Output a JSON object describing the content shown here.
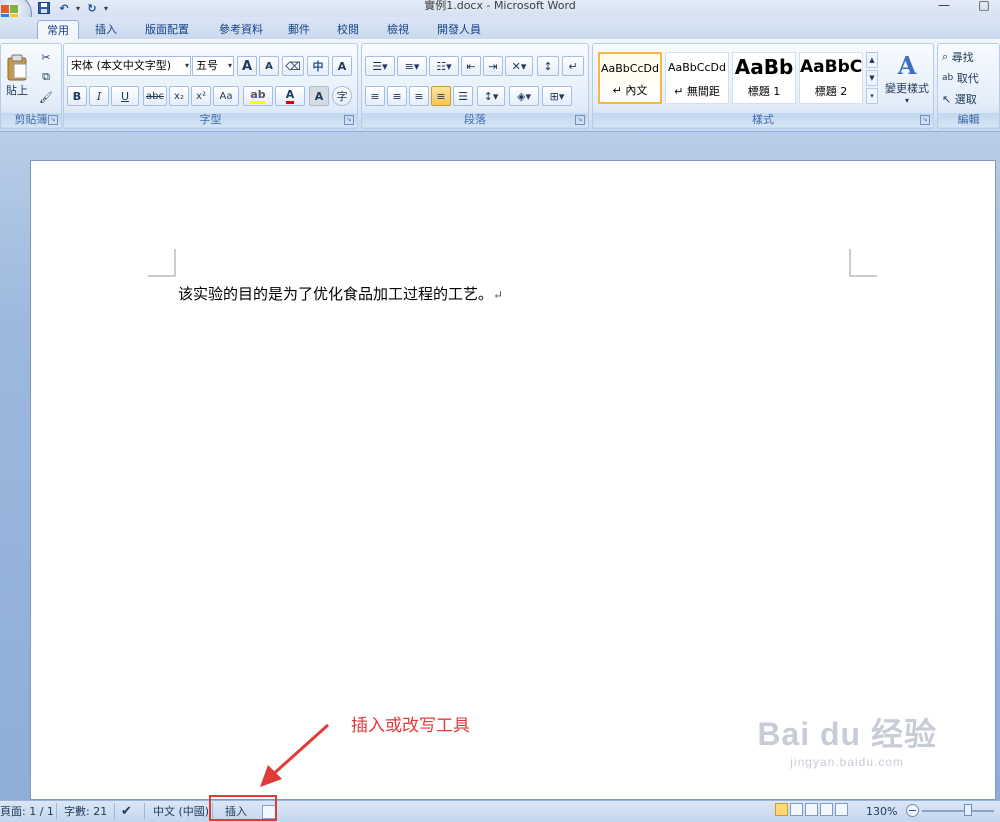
{
  "window": {
    "title": "實例1.docx - Microsoft Word"
  },
  "tabs": [
    "常用",
    "插入",
    "版面配置",
    "參考資料",
    "郵件",
    "校閱",
    "檢視",
    "開發人員"
  ],
  "clipboard": {
    "paste_label": "貼上",
    "group_label": "剪貼簿"
  },
  "font": {
    "font_name": "宋体 (本文中文字型)",
    "font_size": "五号",
    "group_label": "字型",
    "bold": "B",
    "italic": "I",
    "underline": "U",
    "strike": "abc",
    "subscript": "x₂",
    "superscript": "x²",
    "grow": "A",
    "shrink": "A",
    "color_letter": "A",
    "aa": "Aa"
  },
  "paragraph": {
    "group_label": "段落"
  },
  "styles": {
    "group_label": "樣式",
    "items": [
      {
        "sample": "AaBbCcDd",
        "name": "↵ 內文"
      },
      {
        "sample": "AaBbCcDd",
        "name": "↵ 無間距"
      },
      {
        "sample": "AaBb",
        "name": "標題 1"
      },
      {
        "sample": "AaBbC",
        "name": "標題 2"
      }
    ],
    "change_label": "變更樣式"
  },
  "editing": {
    "group_label": "編輯",
    "find": "尋找",
    "replace": "取代",
    "select": "選取"
  },
  "document": {
    "text": "该实验的目的是为了优化食品加工过程的工艺。",
    "para_mark": "↵"
  },
  "annotation": {
    "text": "插入或改写工具"
  },
  "watermark": {
    "brand": "Bai du 经验",
    "url": "jingyan.baidu.com"
  },
  "status": {
    "page": "頁面: 1 / 1",
    "words": "字數: 21",
    "language": "中文 (中國)",
    "insert_mode": "插入",
    "zoom": "130%"
  },
  "colors": {
    "annotation": "#e03a3a",
    "ribbon_accent": "#15428b",
    "highlight": "#e23a3a"
  }
}
